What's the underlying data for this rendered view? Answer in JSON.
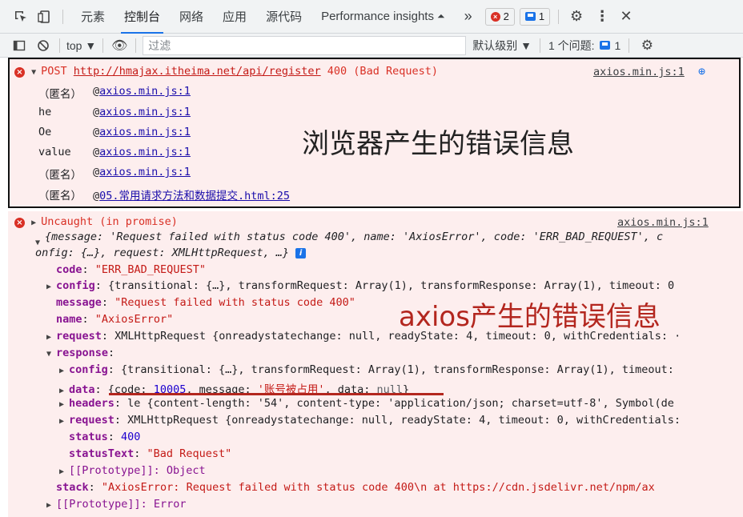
{
  "tabbar": {
    "tabs": [
      "元素",
      "控制台",
      "网络",
      "应用",
      "源代码",
      "Performance insights"
    ],
    "more": "»",
    "error_count": "2",
    "message_count": "1"
  },
  "filterbar": {
    "context": "top ▼",
    "filter_placeholder": "过滤",
    "levels": "默认级别 ▼",
    "issues_label": "1 个问题:",
    "issues_count": "1"
  },
  "error1": {
    "method": "POST",
    "url": "http://hmajax.itheima.net/api/register",
    "status": "400 (Bad Request)",
    "source": "axios.min.js:1",
    "stack": [
      {
        "fn": "（匿名）",
        "src": "axios.min.js:1"
      },
      {
        "fn": "he",
        "src": "axios.min.js:1"
      },
      {
        "fn": "Oe",
        "src": "axios.min.js:1"
      },
      {
        "fn": "value",
        "src": "axios.min.js:1"
      },
      {
        "fn": "（匿名）",
        "src": "axios.min.js:1"
      },
      {
        "fn": "（匿名）",
        "src": "05.常用请求方法和数据提交.html:25"
      }
    ],
    "annotation": "浏览器产生的错误信息"
  },
  "error2": {
    "title": "Uncaught (in promise)",
    "source": "axios.min.js:1",
    "summary1": "{message: 'Request failed with status code 400', name: 'AxiosError', code: 'ERR_BAD_REQUEST', c",
    "summary2": "onfig: {…}, request: XMLHttpRequest, …}",
    "code_key": "code",
    "code_val": "\"ERR_BAD_REQUEST\"",
    "config_key": "config",
    "config_val": "{transitional: {…}, transformRequest: Array(1), transformResponse: Array(1), timeout: 0",
    "message_key": "message",
    "message_val": "\"Request failed with status code 400\"",
    "name_key": "name",
    "name_val": "\"AxiosError\"",
    "request_key": "request",
    "request_val": "XMLHttpRequest {onreadystatechange: null, readyState: 4, timeout: 0, withCredentials: ·",
    "response_key": "response",
    "r_config_key": "config",
    "r_config_val": "{transitional: {…}, transformRequest: Array(1), transformResponse: Array(1), timeout:",
    "r_data_key": "data",
    "r_data_pre": "{code: ",
    "r_data_code": "10005",
    "r_data_mid": ", message: ",
    "r_data_msg": "'账号被占用'",
    "r_data_post": ", data: ",
    "r_data_null": "null",
    "r_data_end": "}",
    "r_headers_key": "headers",
    "r_headers_val": "le {content-length: '54', content-type: 'application/json; charset=utf-8', Symbol(de",
    "r_request_key": "request",
    "r_request_val": "XMLHttpRequest {onreadystatechange: null, readyState: 4, timeout: 0, withCredentials:",
    "r_status_key": "status",
    "r_status_val": "400",
    "r_statusText_key": "statusText",
    "r_statusText_val": "\"Bad Request\"",
    "r_proto": "[[Prototype]]: Object",
    "stack_key": "stack",
    "stack_val": "\"AxiosError: Request failed with status code 400\\n    at https://cdn.jsdelivr.net/npm/ax",
    "proto": "[[Prototype]]: Error",
    "annotation": "axios产生的错误信息"
  }
}
